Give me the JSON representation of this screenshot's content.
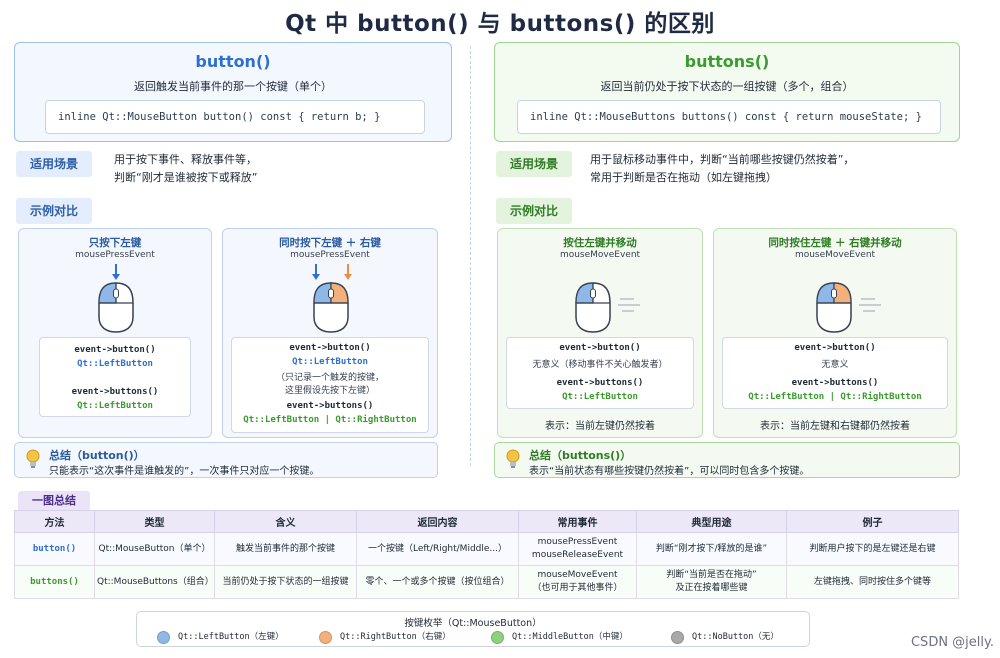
{
  "title": "Qt 中 button() 与 buttons() 的区别",
  "colors": {
    "blue": "#2e6fd1",
    "orange": "#e8903f",
    "green": "#3a9b2e",
    "gray": "#9a9a9a",
    "purple": "#4b2f86"
  },
  "left": {
    "name": "button()",
    "desc": "返回触发当前事件的那一个按键（单个）",
    "code": "inline Qt::MouseButton button() const { return b; }",
    "scene_tag": "适用场景",
    "scene_lines": [
      "用于按下事件、释放事件等，",
      "判断“刚才是谁被按下或释放”"
    ],
    "example_tag": "示例对比",
    "card1": {
      "title": "只按下左键",
      "event": "mousePressEvent",
      "lines": [
        "event->button()",
        "Qt::LeftButton",
        "event->buttons()",
        "Qt::LeftButton"
      ]
    },
    "card2": {
      "title": "同时按下左键 ＋ 右键",
      "event": "mousePressEvent",
      "lines": [
        "event->button()",
        "Qt::LeftButton",
        "（只记录一个触发的按键，",
        "这里假设先按下左键）",
        "event->buttons()",
        "Qt::LeftButton | Qt::RightButton"
      ]
    },
    "summary_title": "总结（button()）",
    "summary_desc": "只能表示“这次事件是谁触发的”，一次事件只对应一个按键。"
  },
  "right": {
    "name": "buttons()",
    "desc": "返回当前仍处于按下状态的一组按键（多个，组合）",
    "code": "inline Qt::MouseButtons buttons() const { return mouseState; }",
    "scene_tag": "适用场景",
    "scene_lines": [
      "用于鼠标移动事件中，判断“当前哪些按键仍然按着”，",
      "常用于判断是否在拖动（如左键拖拽）"
    ],
    "example_tag": "示例对比",
    "card1": {
      "title": "按住左键并移动",
      "event": "mouseMoveEvent",
      "lines": [
        "event->button()",
        "无意义（移动事件不关心触发者）",
        "event->buttons()",
        "Qt::LeftButton"
      ],
      "foot": "表示：当前左键仍然按着"
    },
    "card2": {
      "title": "同时按住左键 ＋ 右键并移动",
      "event": "mouseMoveEvent",
      "lines": [
        "event->button()",
        "无意义",
        "event->buttons()",
        "Qt::LeftButton | Qt::RightButton"
      ],
      "foot": "表示：当前左键和右键都仍然按着"
    },
    "summary_title": "总结（buttons()）",
    "summary_desc": "表示“当前状态有哪些按键仍然按着”，可以同时包含多个按键。"
  },
  "overview": {
    "tag": "一图总结",
    "headers": [
      "方法",
      "类型",
      "含义",
      "返回内容",
      "常用事件",
      "典型用途",
      "例子"
    ],
    "rows": [
      [
        "button()",
        "Qt::MouseButton（单个）",
        "触发当前事件的那个按键",
        "一个按键（Left/Right/Middle...）",
        "mousePressEvent\nmouseReleaseEvent",
        "判断“刚才按下/释放的是谁”",
        "判断用户按下的是左键还是右键"
      ],
      [
        "buttons()",
        "Qt::MouseButtons（组合）",
        "当前仍处于按下状态的一组按键",
        "零个、一个或多个按键（按位组合）",
        "mouseMoveEvent\n（也可用于其他事件）",
        "判断“当前是否在拖动”\n及正在按着哪些键",
        "左键拖拽、同时按住多个键等"
      ]
    ]
  },
  "legend": {
    "title": "按键枚举（Qt::MouseButton）",
    "items": [
      {
        "label": "Qt::LeftButton（左键）",
        "color": "#8fb8e8"
      },
      {
        "label": "Qt::RightButton（右键）",
        "color": "#f2b07a"
      },
      {
        "label": "Qt::MiddleButton（中键）",
        "color": "#8fd07f"
      },
      {
        "label": "Qt::NoButton（无）",
        "color": "#a9a9a9"
      }
    ]
  },
  "watermark": "CSDN @jelly."
}
